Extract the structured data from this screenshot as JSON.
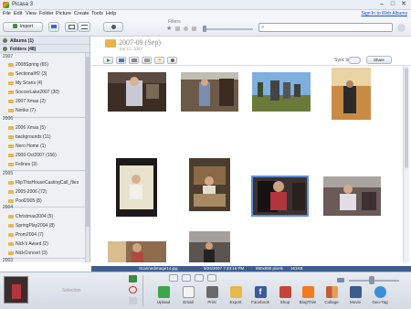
{
  "window": {
    "title": "Picasa 3",
    "minimize": "–",
    "maximize": "□",
    "close": "✕"
  },
  "menu": {
    "items": [
      "File",
      "Edit",
      "View",
      "Folder",
      "Picture",
      "Create",
      "Tools",
      "Help"
    ],
    "signin_link": "Sign In to Web Albums"
  },
  "toolbar": {
    "import_label": "Import",
    "filters_label": "Filters",
    "search_placeholder": ""
  },
  "library": {
    "albums_header": "Albums (1)",
    "folders_header": "Folders (48)",
    "groups": [
      {
        "year": "2007",
        "folders": [
          "2008Spring (65)",
          "SectionalH2 (3)",
          "My Scans (4)",
          "SoccerLake2007 (30)",
          "2007 Xmas (2)",
          "Noriko (7)"
        ]
      },
      {
        "year": "2006",
        "folders": [
          "2006 Xmas (5)",
          "backgrounds (11)",
          "Nero Home (1)",
          "2006-Oct2007 (156)",
          "Felines (3)"
        ]
      },
      {
        "year": "2005",
        "folders": [
          "FlipThisHouseCastingCall_files",
          "2005-2006 (72)",
          "Pool2005 (8)"
        ]
      },
      {
        "year": "2004",
        "folders": [
          "Christmas2004 (5)",
          "SpringPlay2004 (8)",
          "Prom2004 (7)",
          "Nick's Award (2)",
          "NickConcert (3)"
        ]
      },
      {
        "year": "2003",
        "folders": []
      }
    ]
  },
  "main": {
    "folder_title": "2007-09 (Sep)",
    "folder_date": "Jun 11, 2003",
    "sync_label": "Sync to Web",
    "share_label": "Share"
  },
  "statusbar": {
    "filename": "ScannedImage14.jpg",
    "datetime": "9/26/2007 7:23:19 PM",
    "dimensions": "960x890 pixels",
    "filesize": "161KB"
  },
  "tray": {
    "selection_label": "Selection",
    "actions": [
      {
        "name": "upload",
        "label": "Upload"
      },
      {
        "name": "email",
        "label": "Email"
      },
      {
        "name": "print",
        "label": "Print"
      },
      {
        "name": "export",
        "label": "Export"
      },
      {
        "name": "facebook",
        "label": "Facebook"
      },
      {
        "name": "shop",
        "label": "Shop"
      },
      {
        "name": "blogthis",
        "label": "BlogThis!"
      },
      {
        "name": "collage",
        "label": "Collage"
      },
      {
        "name": "movie",
        "label": "Movie"
      },
      {
        "name": "geotag",
        "label": "Geo-Tag"
      }
    ]
  },
  "colors": {
    "status_bar": "#3f5d8f",
    "link": "#1a4ed6",
    "selection_outline": "#5d8ed8",
    "folder_icon": "#e9b650"
  }
}
